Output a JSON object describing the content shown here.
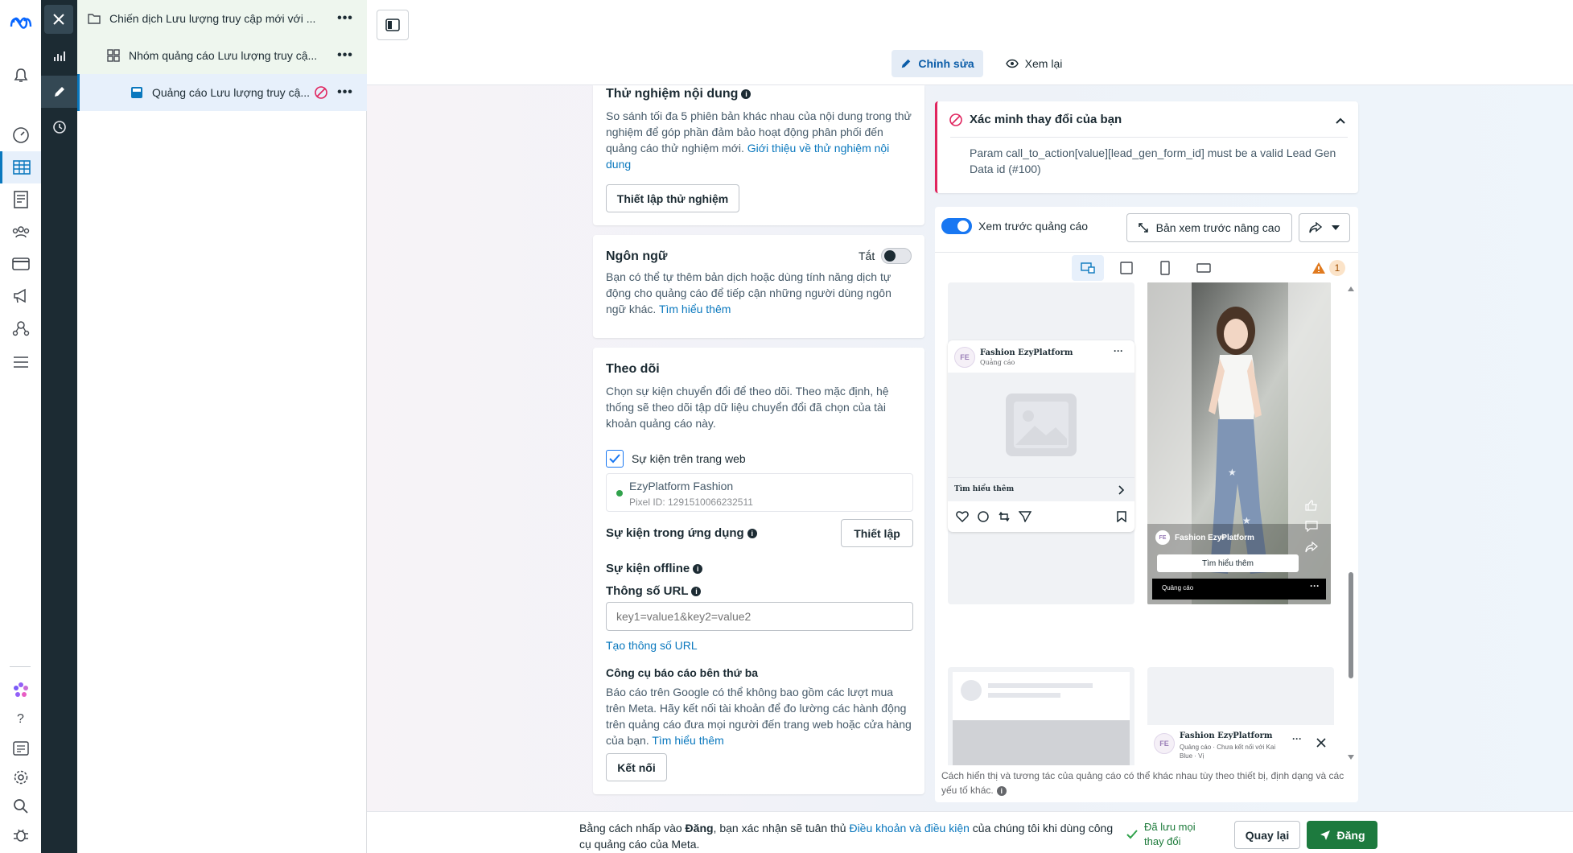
{
  "tree": {
    "campaign": "Chiến dịch Lưu lượng truy cập mới với ...",
    "adset": "Nhóm quảng cáo Lưu lượng truy cậ...",
    "ad": "Quảng cáo Lưu lượng truy cậ..."
  },
  "modes": {
    "edit": "Chỉnh sửa",
    "review": "Xem lại"
  },
  "content_test": {
    "title": "Thử nghiệm nội dung",
    "desc": "So sánh tối đa 5 phiên bản khác nhau của nội dung trong thử nghiệm để góp phần đảm bảo hoạt động phân phối đến quảng cáo thử nghiệm mới.",
    "link": "Giới thiệu về thử nghiệm nội dung",
    "button": "Thiết lập thử nghiệm"
  },
  "language": {
    "title": "Ngôn ngữ",
    "toggle_label": "Tắt",
    "desc": "Bạn có thể tự thêm bản dịch hoặc dùng tính năng dịch tự động cho quảng cáo để tiếp cận những người dùng ngôn ngữ khác.",
    "link": "Tìm hiểu thêm"
  },
  "tracking": {
    "title": "Theo dõi",
    "desc": "Chọn sự kiện chuyển đổi để theo dõi. Theo mặc định, hệ thống sẽ theo dõi tập dữ liệu chuyển đổi đã chọn của tài khoản quảng cáo này.",
    "web_events": "Sự kiện trên trang web",
    "pixel_name": "EzyPlatform Fashion",
    "pixel_id": "Pixel ID: 1291510066232511",
    "app_events": "Sự kiện trong ứng dụng",
    "app_button": "Thiết lập",
    "offline_events": "Sự kiện offline",
    "url_params": "Thông số URL",
    "url_placeholder": "key1=value1&key2=value2",
    "build_url": "Tạo thông số URL",
    "third_party_title": "Công cụ báo cáo bên thứ ba",
    "third_party_desc": "Báo cáo trên Google có thể không bao gồm các lượt mua trên Meta. Hãy kết nối tài khoản để đo lường các hành động trên quảng cáo đưa mọi người đến trang web hoặc cửa hàng của bạn.",
    "third_party_link": "Tìm hiểu thêm",
    "connect_button": "Kết nối"
  },
  "error": {
    "title": "Xác minh thay đổi của bạn",
    "message": "Param call_to_action[value][lead_gen_form_id] must be a valid Lead Gen Data id (#100)"
  },
  "preview": {
    "toggle_label": "Xem trước quảng cáo",
    "advanced_button": "Bản xem trước nâng cao",
    "warning_count": "1",
    "page_name": "Fashion EzyPlatform",
    "sponsored": "Quảng cáo",
    "cta": "Tìm hiểu thêm",
    "story_cta": "Tìm hiểu thêm",
    "story_page": "Fashion EzyPlatform",
    "story_sponsored": "Quảng cáo",
    "reels_page": "Fashion EzyPlatform",
    "reels_sub": "Quảng cáo · Chưa kết nối với Kai Blue · Vị",
    "footnote": "Cách hiển thị và tương tác của quảng cáo có thể khác nhau tùy theo thiết bị, định dạng và các yếu tố khác."
  },
  "bottom": {
    "consent_prefix": "Bằng cách nhấp vào",
    "consent_bold": "Đăng",
    "consent_mid": ", bạn xác nhận sẽ tuân thủ",
    "consent_link": "Điều khoản và điều kiện",
    "consent_suffix": "của chúng tôi khi dùng công cụ quảng cáo của Meta.",
    "saved": "Đã lưu mọi thay đổi",
    "back": "Quay lại",
    "publish": "Đăng"
  },
  "colors": {
    "primary": "#1877f2",
    "publish": "#1d7a3e",
    "error": "#e0245e",
    "rail": "#1c2b33"
  }
}
